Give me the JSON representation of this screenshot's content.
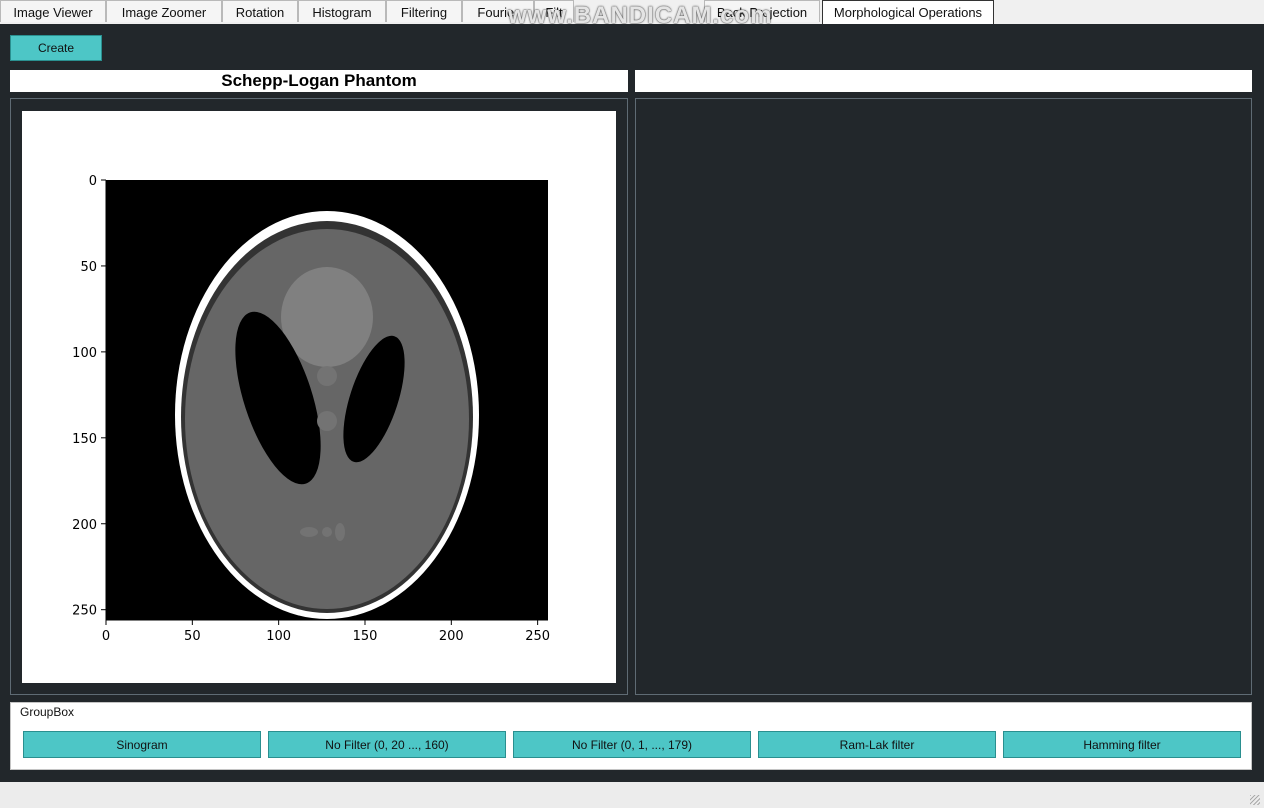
{
  "tabs": [
    {
      "label": "Image Viewer"
    },
    {
      "label": "Image Zoomer"
    },
    {
      "label": "Rotation"
    },
    {
      "label": "Histogram"
    },
    {
      "label": "Filtering"
    },
    {
      "label": "Fourier"
    },
    {
      "label": "Filt"
    },
    {
      "label": "Back Projection"
    },
    {
      "label": "Morphological Operations"
    }
  ],
  "active_tab": "Morphological Operations",
  "watermark": "www.BANDICAM.com",
  "toolbar": {
    "create_label": "Create"
  },
  "left_panel": {
    "title": "Schepp-Logan Phantom"
  },
  "right_panel": {
    "title": ""
  },
  "groupbox": {
    "label": "GroupBox",
    "buttons": [
      {
        "label": "Sinogram"
      },
      {
        "label": "No Filter (0, 20 ..., 160)"
      },
      {
        "label": "No Filter (0, 1, ..., 179)"
      },
      {
        "label": "Ram-Lak filter"
      },
      {
        "label": "Hamming filter"
      }
    ]
  },
  "chart_data": {
    "type": "image",
    "title": "",
    "xlim": [
      0,
      256
    ],
    "ylim": [
      256,
      0
    ],
    "x_ticks": [
      "0",
      "50",
      "100",
      "150",
      "200",
      "250"
    ],
    "y_ticks": [
      "0",
      "50",
      "100",
      "150",
      "200",
      "250"
    ],
    "colormap": "gray"
  }
}
